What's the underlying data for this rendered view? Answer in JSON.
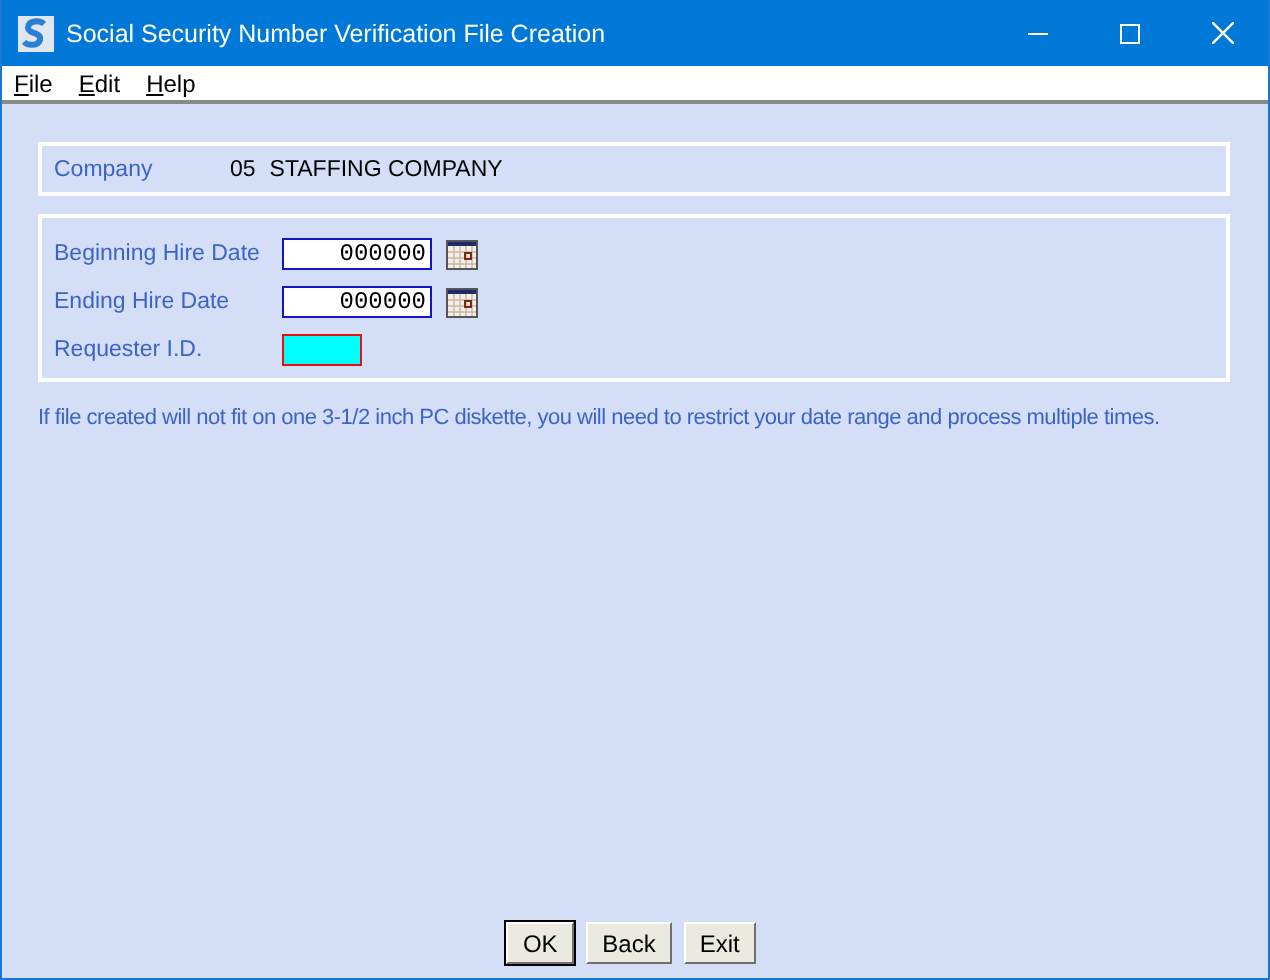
{
  "window": {
    "title": "Social Security Number Verification File Creation"
  },
  "menu": [
    {
      "label": "File"
    },
    {
      "label": "Edit"
    },
    {
      "label": "Help"
    }
  ],
  "company": {
    "label": "Company",
    "code": "05",
    "name": "STAFFING COMPANY"
  },
  "fields": [
    {
      "label": "Beginning Hire Date",
      "value": "000000",
      "kind": "date",
      "required": false
    },
    {
      "label": "Ending Hire Date",
      "value": "000000",
      "kind": "date",
      "required": false
    },
    {
      "label": "Requester I.D.",
      "kind": "text",
      "required": true
    }
  ],
  "note": "If file created will not fit on one 3-1/2 inch PC diskette, you will need to restrict your date range and process multiple times.",
  "buttons": [
    {
      "label": "OK",
      "default": true
    },
    {
      "label": "Back",
      "default": false
    },
    {
      "label": "Exit",
      "default": false
    }
  ]
}
